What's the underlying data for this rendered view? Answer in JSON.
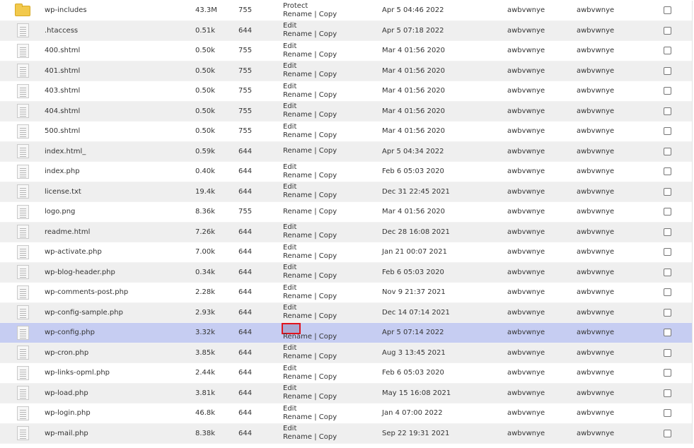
{
  "labels": {
    "rename": "Rename",
    "copy": "Copy",
    "separator": " | ",
    "edit": "Edit",
    "protect": "Protect"
  },
  "files": [
    {
      "name": "wp-includes",
      "size": "43.3M",
      "perm": "755",
      "date": "Apr 5 04:46 2022",
      "user": "awbvwnye",
      "group": "awbvwnye",
      "type": "folder",
      "top_action": "Protect"
    },
    {
      "name": ".htaccess",
      "size": "0.51k",
      "perm": "644",
      "date": "Apr 5 07:18 2022",
      "user": "awbvwnye",
      "group": "awbvwnye",
      "type": "file",
      "top_action": "Edit"
    },
    {
      "name": "400.shtml",
      "size": "0.50k",
      "perm": "755",
      "date": "Mar 4 01:56 2020",
      "user": "awbvwnye",
      "group": "awbvwnye",
      "type": "file",
      "top_action": "Edit"
    },
    {
      "name": "401.shtml",
      "size": "0.50k",
      "perm": "755",
      "date": "Mar 4 01:56 2020",
      "user": "awbvwnye",
      "group": "awbvwnye",
      "type": "file",
      "top_action": "Edit"
    },
    {
      "name": "403.shtml",
      "size": "0.50k",
      "perm": "755",
      "date": "Mar 4 01:56 2020",
      "user": "awbvwnye",
      "group": "awbvwnye",
      "type": "file",
      "top_action": "Edit"
    },
    {
      "name": "404.shtml",
      "size": "0.50k",
      "perm": "755",
      "date": "Mar 4 01:56 2020",
      "user": "awbvwnye",
      "group": "awbvwnye",
      "type": "file",
      "top_action": "Edit"
    },
    {
      "name": "500.shtml",
      "size": "0.50k",
      "perm": "755",
      "date": "Mar 4 01:56 2020",
      "user": "awbvwnye",
      "group": "awbvwnye",
      "type": "file",
      "top_action": "Edit"
    },
    {
      "name": "index.html_",
      "size": "0.59k",
      "perm": "644",
      "date": "Apr 5 04:34 2022",
      "user": "awbvwnye",
      "group": "awbvwnye",
      "type": "file",
      "top_action": ""
    },
    {
      "name": "index.php",
      "size": "0.40k",
      "perm": "644",
      "date": "Feb 6 05:03 2020",
      "user": "awbvwnye",
      "group": "awbvwnye",
      "type": "file",
      "top_action": "Edit"
    },
    {
      "name": "license.txt",
      "size": "19.4k",
      "perm": "644",
      "date": "Dec 31 22:45 2021",
      "user": "awbvwnye",
      "group": "awbvwnye",
      "type": "file",
      "top_action": "Edit"
    },
    {
      "name": "logo.png",
      "size": "8.36k",
      "perm": "755",
      "date": "Mar 4 01:56 2020",
      "user": "awbvwnye",
      "group": "awbvwnye",
      "type": "file",
      "top_action": ""
    },
    {
      "name": "readme.html",
      "size": "7.26k",
      "perm": "644",
      "date": "Dec 28 16:08 2021",
      "user": "awbvwnye",
      "group": "awbvwnye",
      "type": "file",
      "top_action": "Edit"
    },
    {
      "name": "wp-activate.php",
      "size": "7.00k",
      "perm": "644",
      "date": "Jan 21 00:07 2021",
      "user": "awbvwnye",
      "group": "awbvwnye",
      "type": "file",
      "top_action": "Edit"
    },
    {
      "name": "wp-blog-header.php",
      "size": "0.34k",
      "perm": "644",
      "date": "Feb 6 05:03 2020",
      "user": "awbvwnye",
      "group": "awbvwnye",
      "type": "file",
      "top_action": "Edit"
    },
    {
      "name": "wp-comments-post.php",
      "size": "2.28k",
      "perm": "644",
      "date": "Nov 9 21:37 2021",
      "user": "awbvwnye",
      "group": "awbvwnye",
      "type": "file",
      "top_action": "Edit"
    },
    {
      "name": "wp-config-sample.php",
      "size": "2.93k",
      "perm": "644",
      "date": "Dec 14 07:14 2021",
      "user": "awbvwnye",
      "group": "awbvwnye",
      "type": "file",
      "top_action": "Edit"
    },
    {
      "name": "wp-config.php",
      "size": "3.32k",
      "perm": "644",
      "date": "Apr 5 07:14 2022",
      "user": "awbvwnye",
      "group": "awbvwnye",
      "type": "file",
      "top_action": "Edit",
      "selected": true
    },
    {
      "name": "wp-cron.php",
      "size": "3.85k",
      "perm": "644",
      "date": "Aug 3 13:45 2021",
      "user": "awbvwnye",
      "group": "awbvwnye",
      "type": "file",
      "top_action": "Edit"
    },
    {
      "name": "wp-links-opml.php",
      "size": "2.44k",
      "perm": "644",
      "date": "Feb 6 05:03 2020",
      "user": "awbvwnye",
      "group": "awbvwnye",
      "type": "file",
      "top_action": "Edit"
    },
    {
      "name": "wp-load.php",
      "size": "3.81k",
      "perm": "644",
      "date": "May 15 16:08 2021",
      "user": "awbvwnye",
      "group": "awbvwnye",
      "type": "file",
      "top_action": "Edit"
    },
    {
      "name": "wp-login.php",
      "size": "46.8k",
      "perm": "644",
      "date": "Jan 4 07:00 2022",
      "user": "awbvwnye",
      "group": "awbvwnye",
      "type": "file",
      "top_action": "Edit"
    },
    {
      "name": "wp-mail.php",
      "size": "8.38k",
      "perm": "644",
      "date": "Sep 22 19:31 2021",
      "user": "awbvwnye",
      "group": "awbvwnye",
      "type": "file",
      "top_action": "Edit"
    }
  ]
}
